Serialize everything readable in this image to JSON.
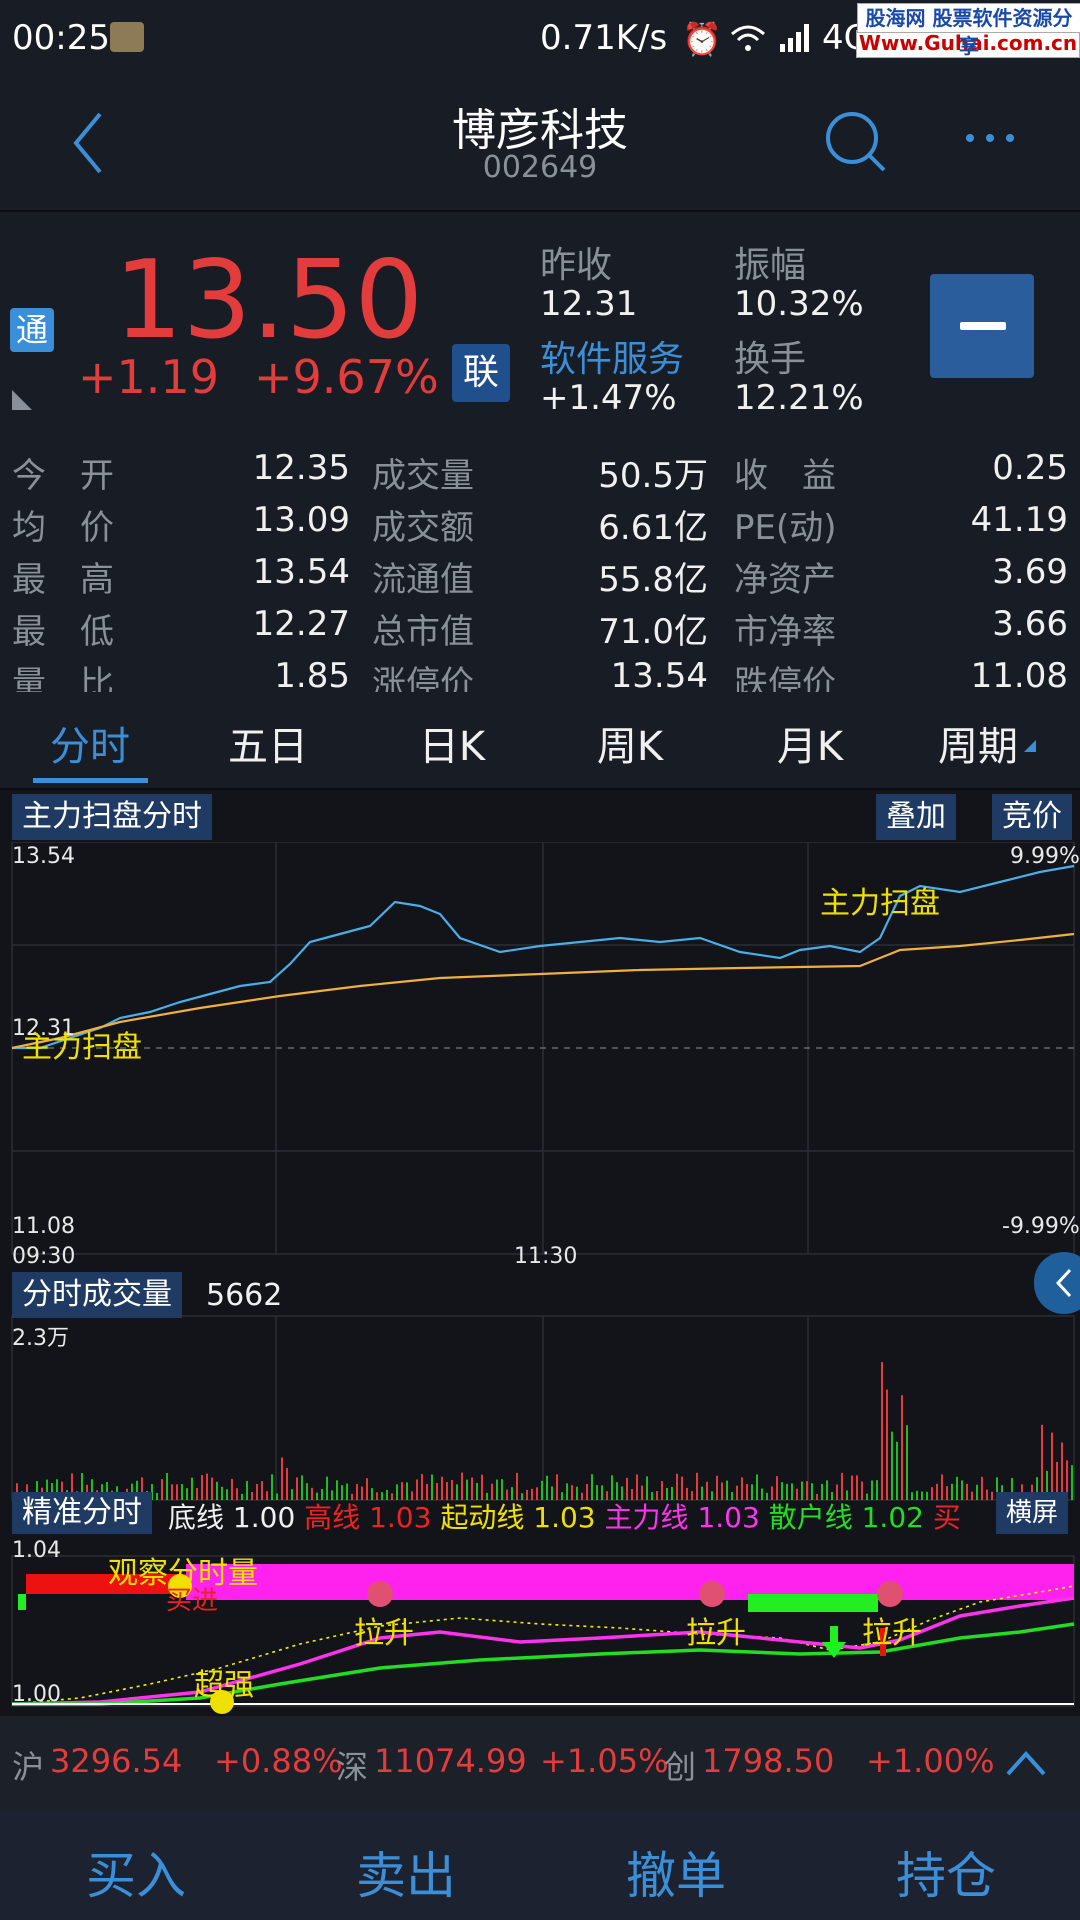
{
  "status_bar": {
    "time": "00:25",
    "speed": "0.71K/s",
    "network": "4G",
    "watermark_top": "股海网 股票软件资源分享",
    "watermark_url": "Www.Guhai.com.cn"
  },
  "header": {
    "back_icon": "chevron-left-icon",
    "title": "博彦科技",
    "code": "002649",
    "search_icon": "search-icon",
    "more_icon": "more-dots-icon"
  },
  "quote": {
    "tong_badge": "通",
    "lian_badge": "联",
    "price": "13.50",
    "change": "+1.19",
    "change_pct": "+9.67%",
    "prev_close_label": "昨收",
    "prev_close": "12.31",
    "amplitude_label": "振幅",
    "amplitude": "10.32%",
    "sector_label": "软件服务",
    "sector_change": "+1.47%",
    "turnover_label": "换手",
    "turnover": "12.21%",
    "remove_button": "—"
  },
  "stats": [
    {
      "l1": "今　开",
      "v1": "12.35",
      "l2": "成交量",
      "v2": "50.5万",
      "l3": "收　益",
      "v3": "0.25"
    },
    {
      "l1": "均　价",
      "v1": "13.09",
      "l2": "成交额",
      "v2": "6.61亿",
      "l3": "PE(动)",
      "v3": "41.19"
    },
    {
      "l1": "最　高",
      "v1": "13.54",
      "l2": "流通值",
      "v2": "55.8亿",
      "l3": "净资产",
      "v3": "3.69"
    },
    {
      "l1": "最　低",
      "v1": "12.27",
      "l2": "总市值",
      "v2": "71.0亿",
      "l3": "市净率",
      "v3": "3.66"
    },
    {
      "l1": "量　比",
      "v1": "1.85",
      "l2": "涨停价",
      "v2": "13.54",
      "l3": "跌停价",
      "v3": "11.08"
    }
  ],
  "tabs": [
    "分时",
    "五日",
    "日K",
    "周K",
    "月K",
    "周期"
  ],
  "intraday": {
    "title": "主力扫盘分时",
    "overlay_button": "叠加",
    "auction_button": "竞价",
    "y_top": "13.54",
    "y_top_pct": "9.99%",
    "y_mid": "12.31",
    "y_bottom": "11.08",
    "y_bottom_pct": "-9.99%",
    "label_a": "主力扫盘",
    "label_b": "主力扫盘",
    "time_start": "09:30",
    "time_mid": "11:30"
  },
  "volume": {
    "title": "分时成交量",
    "value": "5662",
    "y_top": "2.3万"
  },
  "precise": {
    "title": "精准分时",
    "base_label": "底线",
    "base_value": "1.00",
    "high_label": "高线",
    "high_value": "1.03",
    "start_label": "起动线",
    "start_value": "1.03",
    "main_label": "主力线",
    "main_value": "1.03",
    "retail_label": "散户线",
    "retail_value": "1.02",
    "trailing": "买",
    "landscape_button": "横屏",
    "y_top": "1.04",
    "y_bottom": "1.00",
    "watch": "观察分时量",
    "buy": "买进",
    "lift1": "拉升",
    "lift2": "拉升",
    "lift3": "拉升",
    "strong": "超强"
  },
  "ticker": {
    "sh_label": "沪",
    "sh_value": "3296.54",
    "sh_pct": "+0.88%",
    "sz_label": "深",
    "sz_value": "11074.99",
    "sz_pct": "+1.05%",
    "cy_label": "创",
    "cy_value": "1798.50",
    "cy_pct": "+1.00%"
  },
  "actions": [
    "买入",
    "卖出",
    "撤单",
    "持仓"
  ],
  "colors": {
    "red": "#e23c3c",
    "blue": "#3b8fd8",
    "price_line": "#4aaee8",
    "avg_line": "#f0b040"
  }
}
